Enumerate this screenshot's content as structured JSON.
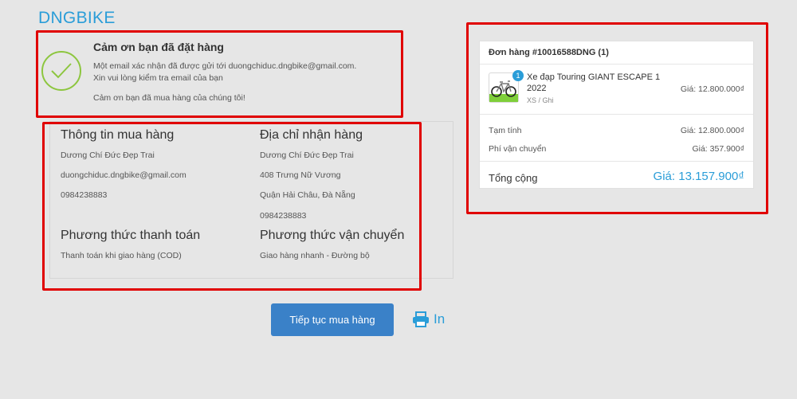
{
  "brand": "DNGBIKE",
  "thanks": {
    "title": "Cảm ơn bạn đã đặt hàng",
    "line1": "Một email xác nhận đã được gửi tới duongchiduc.dngbike@gmail.com.",
    "line2": "Xin vui lòng kiểm tra email của bạn",
    "line3": "Cảm ơn bạn đã mua hàng của chúng tôi!"
  },
  "purchase_info": {
    "title": "Thông tin mua hàng",
    "name": "Dương Chí Đức Đẹp Trai",
    "email": "duongchiduc.dngbike@gmail.com",
    "phone": "0984238883"
  },
  "shipping_address": {
    "title": "Địa chỉ nhận hàng",
    "name": "Dương Chí Đức Đẹp Trai",
    "street": "408 Trưng Nữ Vương",
    "district": "Quận Hải Châu, Đà Nẵng",
    "phone": "0984238883"
  },
  "payment": {
    "title": "Phương thức thanh toán",
    "value": "Thanh toán khi giao hàng (COD)"
  },
  "shipping_method": {
    "title": "Phương thức vận chuyển",
    "value": "Giao hàng nhanh - Đường bộ"
  },
  "order": {
    "header": "Đơn hàng #10016588DNG (1)",
    "item": {
      "qty": "1",
      "name": "Xe đạp Touring GIANT ESCAPE 1 2022",
      "variant": "XS / Ghi",
      "price": "Giá: 12.800.000₫"
    },
    "subtotal_label": "Tạm tính",
    "subtotal_value": "Giá: 12.800.000₫",
    "shipping_label": "Phí vận chuyển",
    "shipping_value": "Giá: 357.900₫",
    "total_label": "Tổng cộng",
    "total_value": "Giá: 13.157.900₫"
  },
  "actions": {
    "continue_label": "Tiếp tục mua hàng",
    "print_label": "In"
  },
  "colors": {
    "accent": "#2a9dd8",
    "button": "#3a81c8",
    "highlight_box": "#e00000",
    "check": "#8dc63f"
  }
}
